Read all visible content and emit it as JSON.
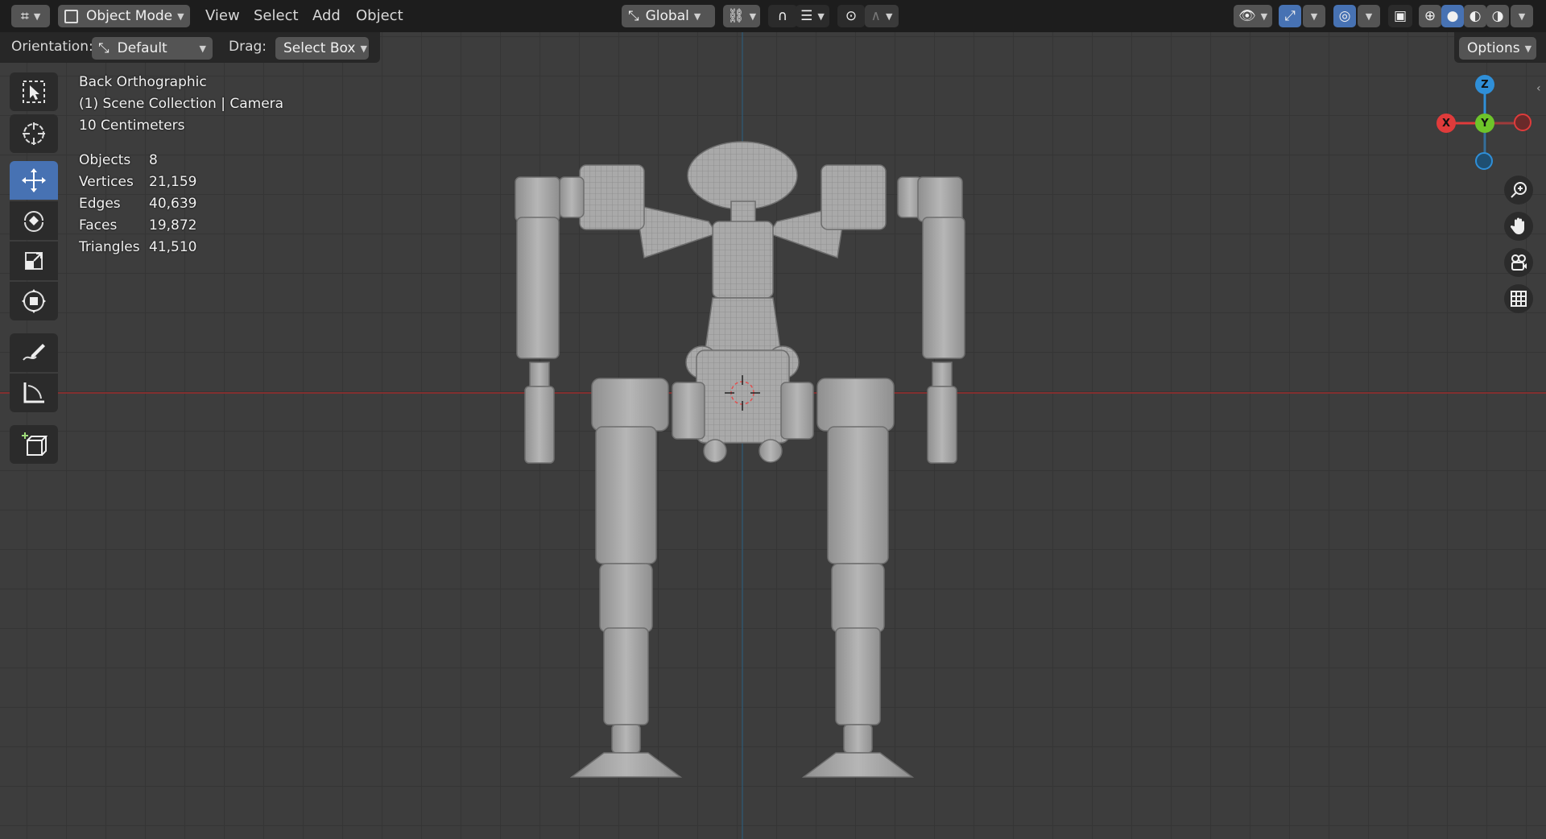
{
  "header": {
    "mode_label": "Object Mode",
    "menus": [
      "View",
      "Select",
      "Add",
      "Object"
    ],
    "transform_orientation": "Global"
  },
  "tool_settings": {
    "orientation_label": "Orientation:",
    "orientation_value": "Default",
    "drag_label": "Drag:",
    "drag_value": "Select Box",
    "options_label": "Options"
  },
  "viewport_info": {
    "view_name": "Back Orthographic",
    "collection": "(1) Scene Collection | Camera",
    "scale": "10 Centimeters"
  },
  "stats": [
    {
      "label": "Objects",
      "value": "8"
    },
    {
      "label": "Vertices",
      "value": "21,159"
    },
    {
      "label": "Edges",
      "value": "40,639"
    },
    {
      "label": "Faces",
      "value": "19,872"
    },
    {
      "label": "Triangles",
      "value": "41,510"
    }
  ],
  "gizmo": {
    "z": "Z",
    "x": "X",
    "y": "Y"
  },
  "colors": {
    "accent": "#4772b3",
    "x_axis": "#e03b3b",
    "y_axis": "#6ec42a",
    "z_axis": "#2f8fd8"
  },
  "icons": {
    "tools": [
      "select-box-icon",
      "cursor-icon",
      "move-icon",
      "rotate-icon",
      "scale-icon",
      "transform-icon",
      "annotate-icon",
      "measure-icon",
      "add-cube-icon"
    ]
  }
}
